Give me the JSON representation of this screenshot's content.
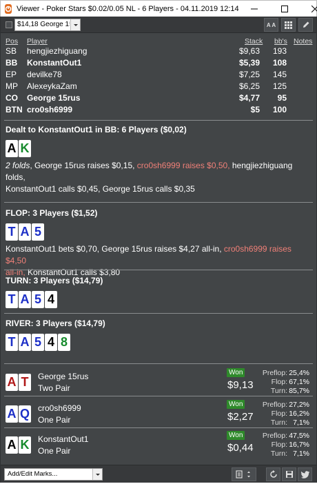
{
  "window": {
    "title": "Viewer - Poker Stars $0.02/0.05 NL - 6 Players - 04.11.2019 12:14"
  },
  "toolbar": {
    "hand_select": "$14,18 George 15rus",
    "font_button": "A A"
  },
  "players": {
    "headers": {
      "pos": "Pos",
      "player": "Player",
      "stack": "Stack",
      "bbs": "bb's",
      "notes": "Notes"
    },
    "rows": [
      {
        "pos": "SB",
        "name": "hengjiezhiguang",
        "stack": "$9,63",
        "bbs": "193",
        "bold": false
      },
      {
        "pos": "BB",
        "name": "KonstantOut1",
        "stack": "$5,39",
        "bbs": "108",
        "bold": true
      },
      {
        "pos": "EP",
        "name": "devilke78",
        "stack": "$7,25",
        "bbs": "145",
        "bold": false
      },
      {
        "pos": "MP",
        "name": "AlexeykaZam",
        "stack": "$6,25",
        "bbs": "125",
        "bold": false
      },
      {
        "pos": "CO",
        "name": "George 15rus",
        "stack": "$4,77",
        "bbs": "95",
        "bold": true
      },
      {
        "pos": "BTN",
        "name": "cro0sh6999",
        "stack": "$5",
        "bbs": "100",
        "bold": true
      }
    ]
  },
  "preflop": {
    "title": "Dealt to KonstantOut1 in BB: 6 Players ($0,02)",
    "cards": [
      {
        "rank": "A",
        "suit": "spade"
      },
      {
        "rank": "K",
        "suit": "club"
      }
    ],
    "line1_a": "2 folds",
    "line1_b": ", George 15rus raises $0,15, ",
    "line1_hl": "cro0sh6999 raises $0,50,",
    "line1_c": " hengjiezhiguang folds,",
    "line2": "KonstantOut1 calls $0,45, George 15rus calls $0,35"
  },
  "flop": {
    "title": "FLOP: 3 Players ($1,52)",
    "cards": [
      {
        "rank": "T",
        "suit": "diamond"
      },
      {
        "rank": "A",
        "suit": "diamond"
      },
      {
        "rank": "5",
        "suit": "diamond"
      }
    ],
    "line1_a": "KonstantOut1 bets $0,70, George 15rus raises $4,27 all-in, ",
    "line1_hl": "cro0sh6999 raises $4,50",
    "line2_hl": "all-in,",
    "line2_b": " KonstantOut1 calls $3,80"
  },
  "turn": {
    "title": "TURN: 3 Players ($14,79)",
    "cards": [
      {
        "rank": "T",
        "suit": "diamond"
      },
      {
        "rank": "A",
        "suit": "diamond"
      },
      {
        "rank": "5",
        "suit": "diamond"
      },
      {
        "rank": "4",
        "suit": "spade"
      }
    ]
  },
  "river": {
    "title": "RIVER: 3 Players ($14,79)",
    "cards": [
      {
        "rank": "T",
        "suit": "diamond"
      },
      {
        "rank": "A",
        "suit": "diamond"
      },
      {
        "rank": "5",
        "suit": "diamond"
      },
      {
        "rank": "4",
        "suit": "spade"
      },
      {
        "rank": "8",
        "suit": "club"
      }
    ]
  },
  "results": [
    {
      "name": "George 15rus",
      "hand": "Two Pair",
      "won_label": "Won",
      "amount": "$9,13",
      "cards": [
        {
          "rank": "A",
          "suit": "heart"
        },
        {
          "rank": "T",
          "suit": "heart"
        }
      ],
      "stats": {
        "preflop_label": "Preflop:",
        "preflop": "25,4%",
        "flop_label": "Flop:",
        "flop": "67,1%",
        "turn_label": "Turn:",
        "turn": "85,7%"
      }
    },
    {
      "name": "cro0sh6999",
      "hand": "One Pair",
      "won_label": "Won",
      "amount": "$2,27",
      "cards": [
        {
          "rank": "A",
          "suit": "diamond"
        },
        {
          "rank": "Q",
          "suit": "diamond"
        }
      ],
      "stats": {
        "preflop_label": "Preflop:",
        "preflop": "27,2%",
        "flop_label": "Flop:",
        "flop": "16,2%",
        "turn_label": "Turn:",
        "turn": "7,1%"
      }
    },
    {
      "name": "KonstantOut1",
      "hand": "One Pair",
      "won_label": "Won",
      "amount": "$0,44",
      "cards": [
        {
          "rank": "A",
          "suit": "spade"
        },
        {
          "rank": "K",
          "suit": "club"
        }
      ],
      "stats": {
        "preflop_label": "Preflop:",
        "preflop": "47,5%",
        "flop_label": "Flop:",
        "flop": "16,7%",
        "turn_label": "Turn:",
        "turn": "7,1%"
      }
    }
  ],
  "bottombar": {
    "marks_select": "Add/Edit Marks..."
  },
  "colors": {
    "panel": "#424547",
    "highlight_action": "#f08078",
    "won_badge": "#2f8a2b",
    "spade": "#000000",
    "heart": "#b01818",
    "diamond": "#1c2fc7",
    "club": "#168a2c"
  }
}
